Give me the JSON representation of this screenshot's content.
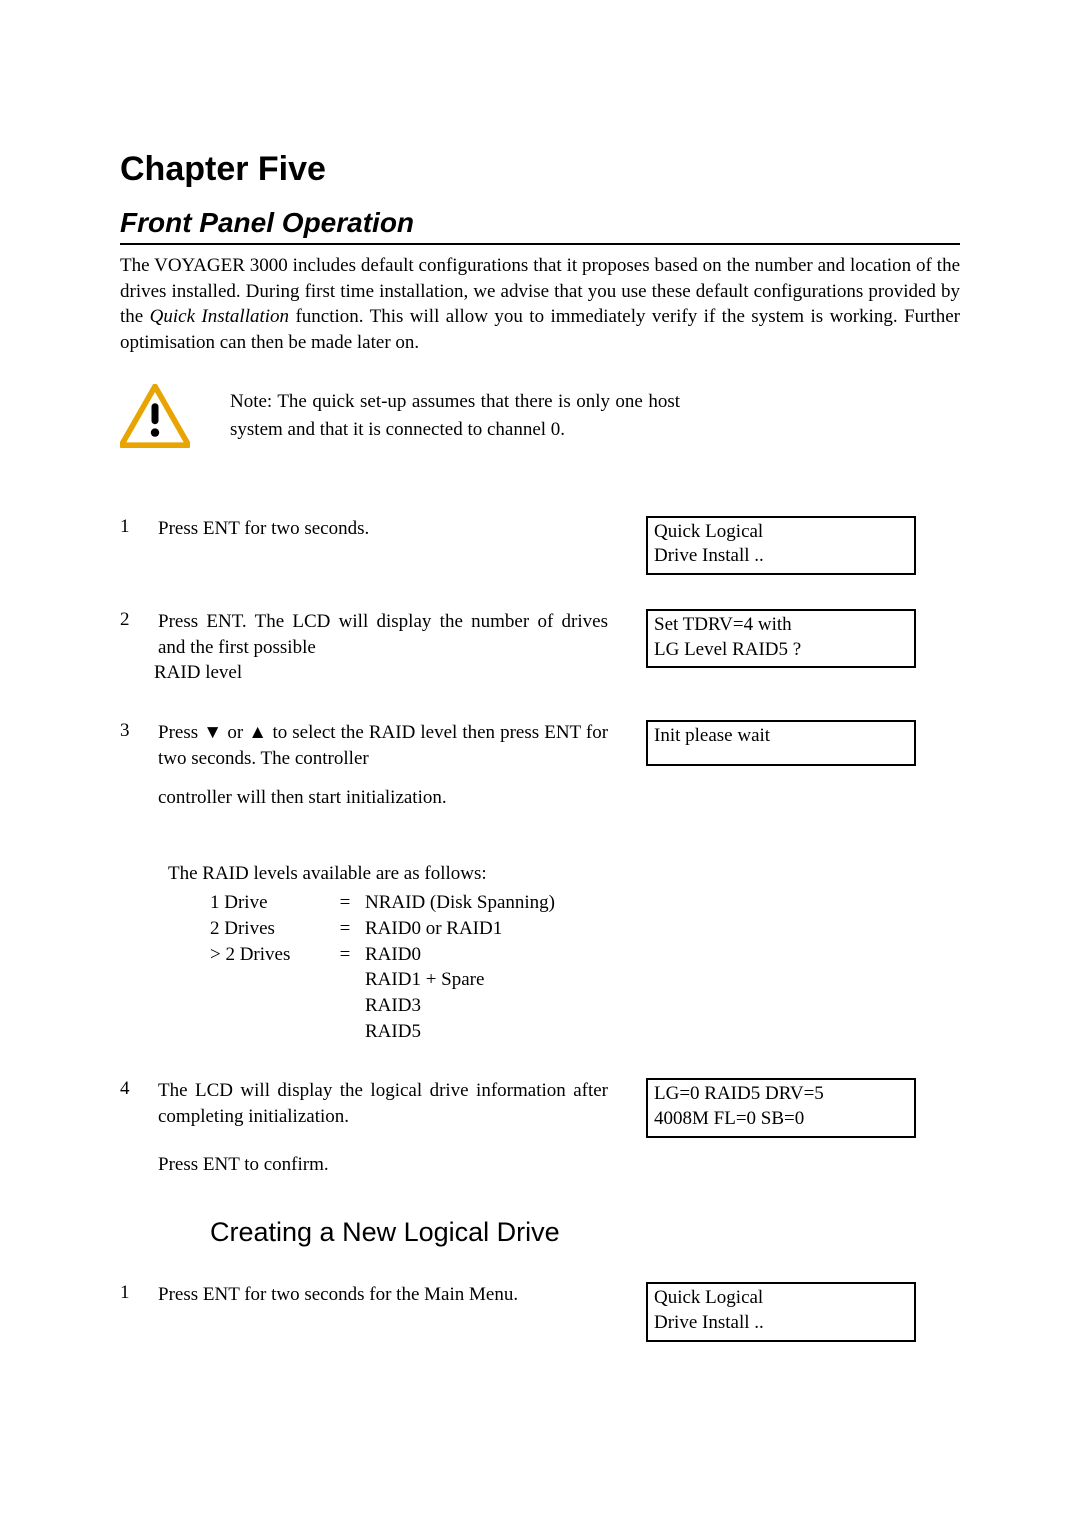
{
  "chapter_title": "Chapter Five",
  "section_title": "Front Panel Operation",
  "intro_prefix": "The VOYAGER 3000 includes default configurations that it proposes based on the number and location of the drives installed.  During first time installation, we advise that you use these default configurations provided by the ",
  "intro_emphasis": "Quick Installation",
  "intro_suffix": " function.  This will allow you to immediately verify if the system is working.  Further optimisation can then be made later on.",
  "note": "Note:   The quick set-up assumes that there is only one host system and that it is connected to channel 0.",
  "steps": {
    "s1": {
      "num": "1",
      "text": "Press ENT for two seconds.",
      "lcd_line1": "Quick Logical",
      "lcd_line2": "Drive Install .."
    },
    "s2": {
      "num": "2",
      "text": "Press ENT.  The LCD will display the number of drives and the first possible",
      "extra": "RAID level",
      "lcd_line1": "Set TDRV=4 with",
      "lcd_line2": "LG Level RAID5 ?"
    },
    "s3": {
      "num": "3",
      "text_prefix": "Press ",
      "down_symbol": "▼",
      "text_mid": " or ",
      "up_symbol": "▲",
      "text_suffix": " to select the RAID level then press ENT for two seconds.  The controller",
      "extra": "controller will then start initialization.",
      "lcd_line1": "Init please wait",
      "lcd_line2": ""
    },
    "raid_intro": "The RAID levels available are as follows:",
    "raid": [
      {
        "a": "1 Drive",
        "b": "=",
        "c": "NRAID (Disk Spanning)"
      },
      {
        "a": "2 Drives",
        "b": "=",
        "c": "RAID0 or RAID1"
      },
      {
        "a": "> 2 Drives",
        "b": "=",
        "c": "RAID0"
      },
      {
        "a": "",
        "b": "",
        "c": "RAID1 +  Spare"
      },
      {
        "a": "",
        "b": "",
        "c": "RAID3"
      },
      {
        "a": "",
        "b": "",
        "c": "RAID5"
      }
    ],
    "s4": {
      "num": "4",
      "text": "The LCD will display the logical drive information after completing initialization.",
      "extra": "Press ENT to confirm.",
      "lcd_line1": "LG=0 RAID5 DRV=5",
      "lcd_line2": "4008M FL=0 SB=0"
    }
  },
  "subsection": "Creating a New Logical Drive",
  "steps2": {
    "c1": {
      "num": "1",
      "text": "Press ENT for two seconds for the Main Menu.",
      "lcd_line1": "Quick Logical",
      "lcd_line2": "Drive Install .."
    }
  }
}
